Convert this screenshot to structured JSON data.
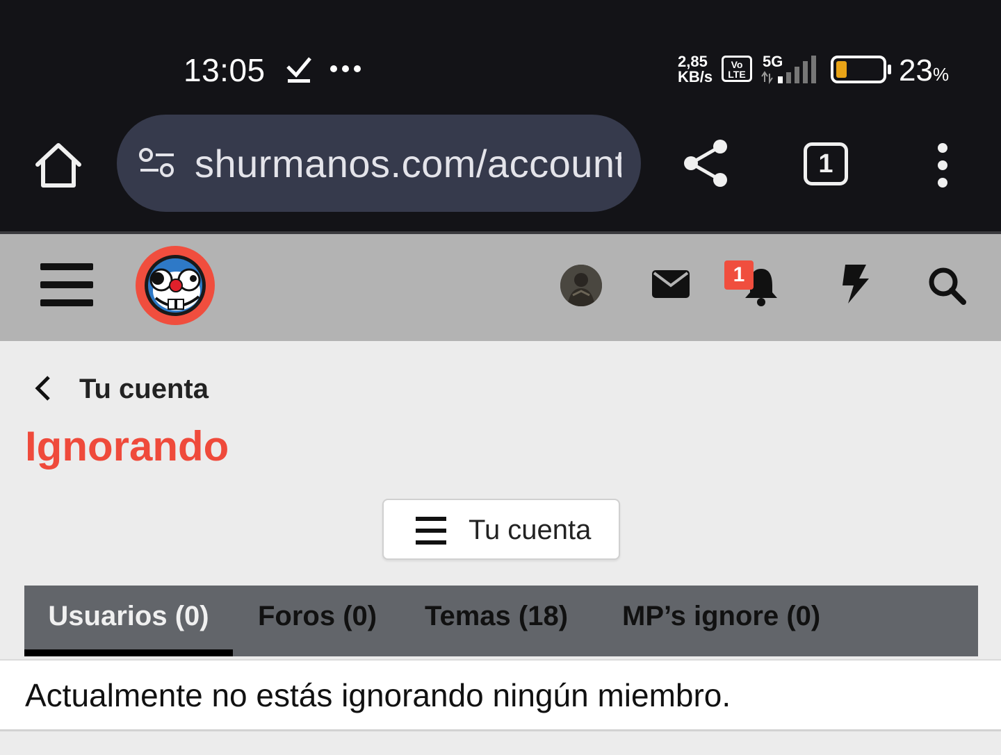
{
  "status_bar": {
    "time": "13:05",
    "net_speed_value": "2,85",
    "net_speed_unit": "KB/s",
    "volte_top": "Vo",
    "volte_bottom": "LTE",
    "network_type": "5G",
    "battery_value": "23",
    "battery_unit": "%",
    "battery_level": 0.23,
    "battery_color": "#e8a317"
  },
  "browser": {
    "url": "shurmanos.com/account/ignored",
    "tab_count": "1"
  },
  "header": {
    "notification_count": "1",
    "brand_color": "#f04e3e"
  },
  "breadcrumb": {
    "label": "Tu cuenta"
  },
  "page": {
    "title": "Ignorando",
    "title_color": "#ef4a3b",
    "account_menu_label": "Tu cuenta",
    "empty_message": "Actualmente no estás ignorando ningún miembro."
  },
  "tabs": [
    {
      "label": "Usuarios (0)",
      "active": true
    },
    {
      "label": "Foros (0)",
      "active": false
    },
    {
      "label": "Temas (18)",
      "active": false
    },
    {
      "label": "MP’s ignore (0)",
      "active": false
    }
  ]
}
